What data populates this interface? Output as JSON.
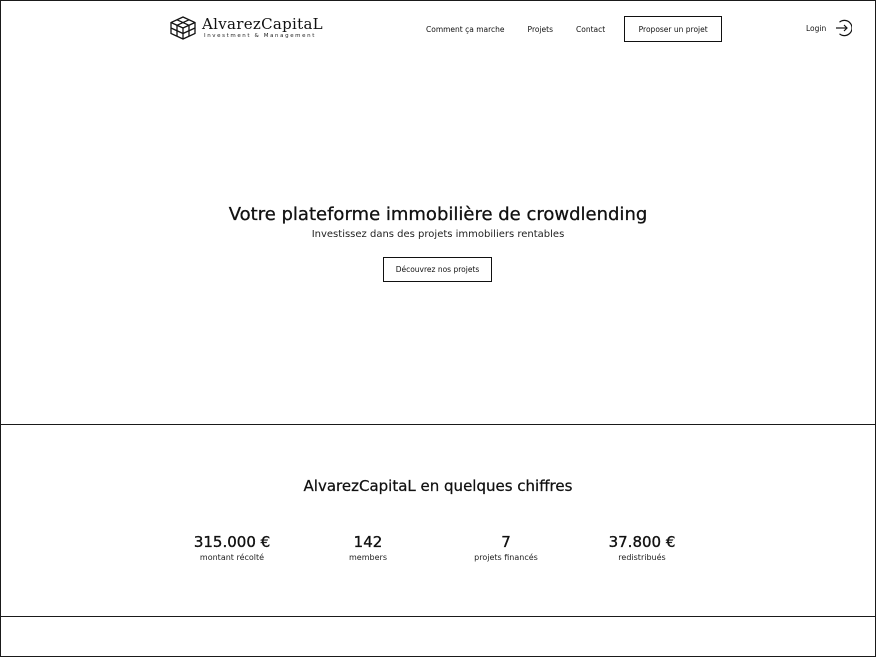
{
  "header": {
    "brand": {
      "name": "AlvarezCapitaL",
      "tagline": "Investment & Management"
    },
    "nav": {
      "how_it_works": "Comment ça marche",
      "projects": "Projets",
      "contact": "Contact"
    },
    "cta_label": "Proposer un projet",
    "login_label": "Login"
  },
  "hero": {
    "title": "Votre plateforme immobilière de crowdlending",
    "subtitle": "Investissez dans des projets immobiliers rentables",
    "button_label": "Découvrez nos projets"
  },
  "figures": {
    "title": "AlvarezCapitaL en quelques chiffres",
    "stats": [
      {
        "value": "315.000 €",
        "label": "montant récolté"
      },
      {
        "value": "142",
        "label": "members"
      },
      {
        "value": "7",
        "label": "projets financés"
      },
      {
        "value": "37.800 €",
        "label": "redistribués"
      }
    ]
  },
  "colors": {
    "text": "#111111",
    "background": "#ffffff",
    "border": "#1a1a1a"
  },
  "icons": {
    "logo": "building-cube-logo-icon",
    "login": "arrow-right-circle-icon"
  }
}
